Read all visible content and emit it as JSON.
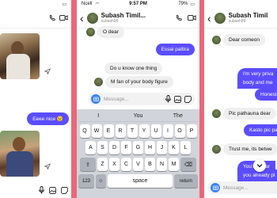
{
  "panel1": {
    "status_time": "",
    "messages": [
      {
        "text": "Eeee nice 😉",
        "type": "out"
      }
    ]
  },
  "panel2": {
    "status": {
      "carrier": "Ncell",
      "time": "9:57 PM",
      "battery": "79%"
    },
    "header": {
      "name": "Subash Timil...",
      "username": "subash99"
    },
    "messages": [
      {
        "text": "O dear",
        "type": "in"
      },
      {
        "text": "Essai paltira",
        "type": "out"
      },
      {
        "text": "Do u know one thing",
        "type": "in"
      },
      {
        "text": "M fan of your body figure",
        "type": "in"
      }
    ],
    "composer": {
      "placeholder": "Message..."
    },
    "keyboard": {
      "suggestions": [
        "I",
        "You",
        "The"
      ],
      "row1": [
        "Q",
        "W",
        "E",
        "R",
        "T",
        "Y",
        "U",
        "I",
        "O",
        "P"
      ],
      "row2": [
        "A",
        "S",
        "D",
        "F",
        "G",
        "H",
        "J",
        "K",
        "L"
      ],
      "row3": [
        "Z",
        "X",
        "C",
        "V",
        "B",
        "N",
        "M"
      ],
      "num_label": "123",
      "space_label": "space",
      "return_label": "return"
    }
  },
  "panel3": {
    "header": {
      "name": "Subash Timil",
      "username": "subash99"
    },
    "messages": [
      {
        "text": "Dear comeon",
        "type": "in"
      },
      {
        "text": "I'm very priva",
        "type": "out"
      },
      {
        "text": "body and me",
        "type": "out"
      },
      {
        "text": "Honest",
        "type": "out"
      },
      {
        "text": "Pic pathauna dear",
        "type": "in"
      },
      {
        "text": "Kasto pic pa",
        "type": "out"
      },
      {
        "text": "Trust me, its betwe",
        "type": "in"
      },
      {
        "text": "You're clear",
        "type": "out"
      },
      {
        "text": "you already pl",
        "type": "out"
      }
    ],
    "composer": {
      "placeholder": "Message..."
    }
  },
  "colors": {
    "outgoing": "#5b4dff",
    "incoming": "#efefef",
    "camera": "#3b82f6",
    "background": "#e8697a"
  }
}
